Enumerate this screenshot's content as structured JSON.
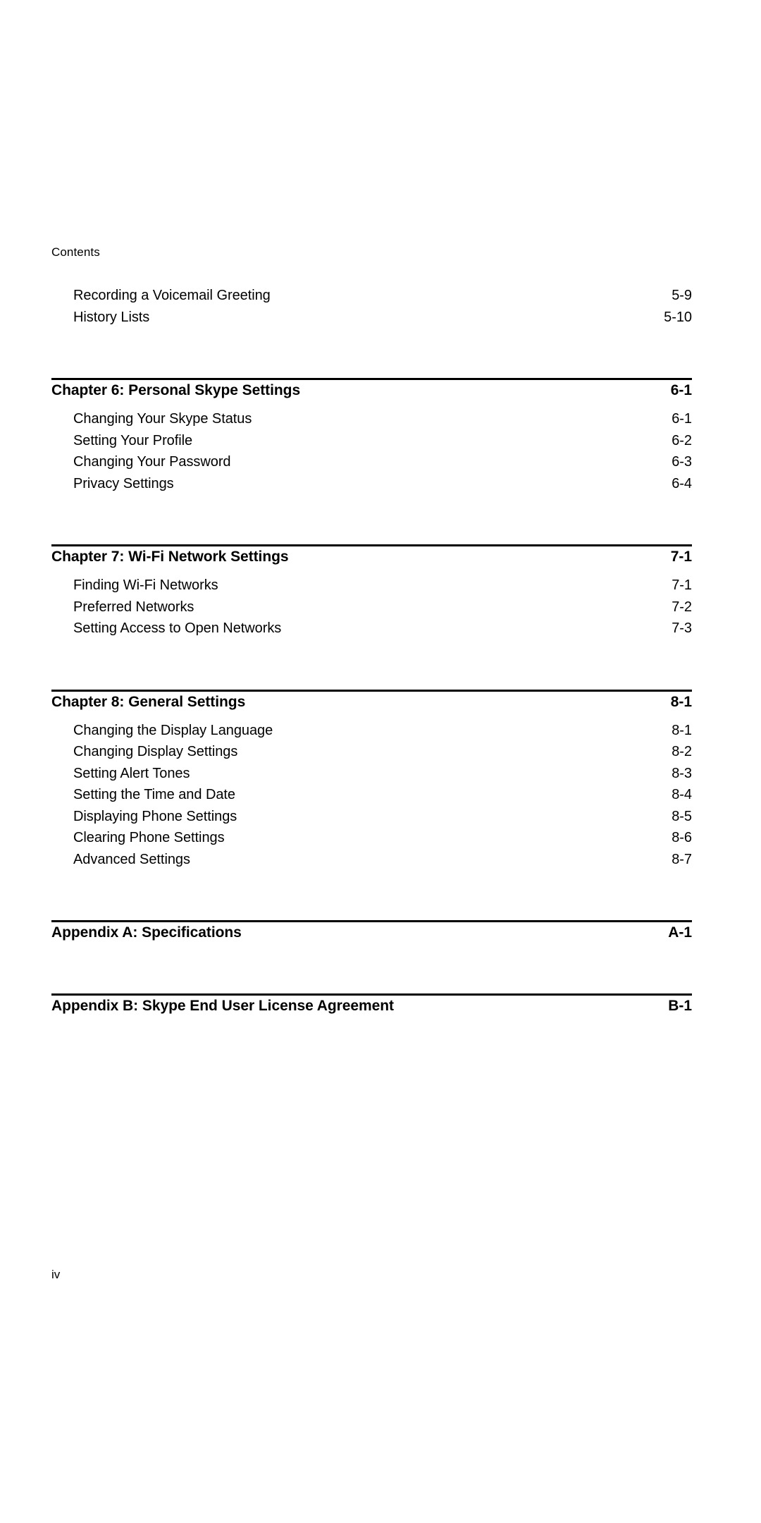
{
  "document": {
    "running_header": "Contents",
    "folio": "iv"
  },
  "toc": {
    "groups": [
      {
        "id": "chapter-5-continued",
        "has_rule": false,
        "heading": null,
        "entries": [
          {
            "title": "Recording a Voicemail Greeting",
            "page": "5-9"
          },
          {
            "title": "History Lists",
            "page": "5-10"
          }
        ]
      },
      {
        "id": "chapter-6",
        "has_rule": true,
        "heading": {
          "title": "Chapter 6: Personal Skype Settings",
          "page": "6-1"
        },
        "entries": [
          {
            "title": "Changing Your Skype Status",
            "page": "6-1"
          },
          {
            "title": "Setting Your Profile",
            "page": "6-2"
          },
          {
            "title": "Changing Your Password",
            "page": "6-3"
          },
          {
            "title": "Privacy Settings",
            "page": "6-4"
          }
        ]
      },
      {
        "id": "chapter-7",
        "has_rule": true,
        "heading": {
          "title": "Chapter 7: Wi-Fi Network Settings",
          "page": "7-1"
        },
        "entries": [
          {
            "title": "Finding Wi-Fi Networks",
            "page": "7-1"
          },
          {
            "title": "Preferred Networks",
            "page": "7-2"
          },
          {
            "title": "Setting Access to Open Networks",
            "page": "7-3"
          }
        ]
      },
      {
        "id": "chapter-8",
        "has_rule": true,
        "heading": {
          "title": "Chapter 8: General Settings",
          "page": "8-1"
        },
        "entries": [
          {
            "title": "Changing the Display Language",
            "page": "8-1"
          },
          {
            "title": "Changing Display Settings",
            "page": "8-2"
          },
          {
            "title": "Setting Alert Tones",
            "page": "8-3"
          },
          {
            "title": "Setting the Time and Date",
            "page": "8-4"
          },
          {
            "title": "Displaying Phone Settings",
            "page": "8-5"
          },
          {
            "title": "Clearing Phone Settings",
            "page": "8-6"
          },
          {
            "title": "Advanced Settings",
            "page": "8-7"
          }
        ]
      },
      {
        "id": "appendix-a",
        "has_rule": true,
        "heading": {
          "title": "Appendix A: Specifications",
          "page": "A-1"
        },
        "entries": []
      },
      {
        "id": "appendix-b",
        "has_rule": true,
        "heading": {
          "title": "Appendix B: Skype End User License Agreement",
          "page": "B-1"
        },
        "entries": []
      }
    ]
  }
}
